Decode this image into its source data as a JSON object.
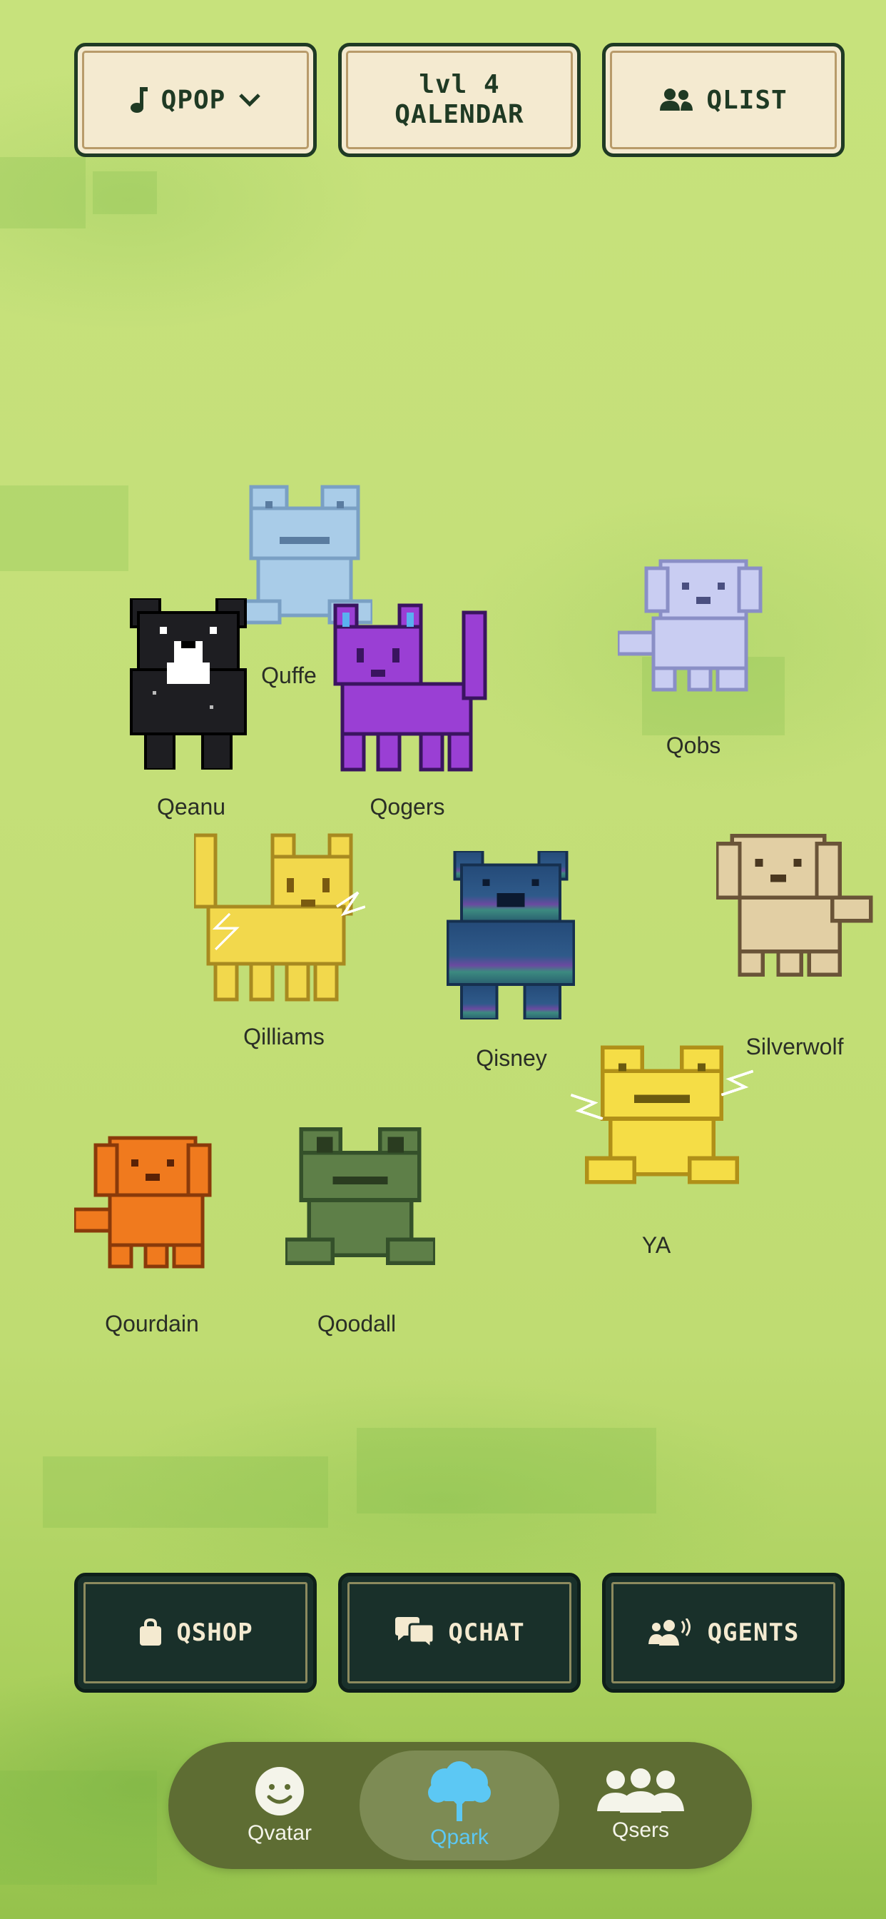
{
  "top_bar": {
    "music_label": "QPOP",
    "calendar_line1": "lvl 4",
    "calendar_line2": "QALENDAR",
    "list_label": "QLIST"
  },
  "characters": [
    {
      "name": "Quffe",
      "color": "#a9cce8"
    },
    {
      "name": "Qeanu",
      "color": "#1e1e22"
    },
    {
      "name": "Qogers",
      "color": "#9a3fd4"
    },
    {
      "name": "Qobs",
      "color": "#c9cdf2"
    },
    {
      "name": "Qilliams",
      "color": "#f2d84c"
    },
    {
      "name": "Qisney",
      "color": "#2f5a8a"
    },
    {
      "name": "Silverwolf",
      "color": "#e2cfa4"
    },
    {
      "name": "YA",
      "color": "#f5dd46"
    },
    {
      "name": "Qourdain",
      "color": "#f07a1e"
    },
    {
      "name": "Qoodall",
      "color": "#5e7f48"
    }
  ],
  "bottom_actions": {
    "shop_label": "QSHOP",
    "chat_label": "QCHAT",
    "agents_label": "QGENTS"
  },
  "tabs": [
    {
      "label": "Qvatar",
      "icon": "smiley-icon"
    },
    {
      "label": "Qpark",
      "icon": "tree-icon",
      "active": true
    },
    {
      "label": "Qsers",
      "icon": "people-icon"
    }
  ],
  "colors": {
    "accent": "#5cc8f4",
    "dark_button": "#19302a",
    "light_button": "#f4ead0"
  }
}
